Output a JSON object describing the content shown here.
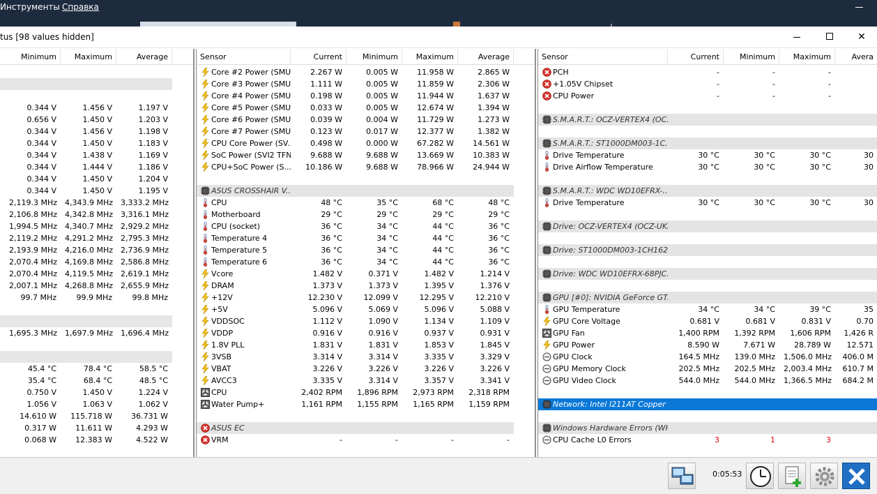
{
  "menu": {
    "tools": "Инструменты",
    "help": "Справка"
  },
  "window": {
    "title": "tus [98 values hidden]"
  },
  "panel1": {
    "headers": [
      "Minimum",
      "Maximum",
      "Average"
    ],
    "rows": [
      {
        "kind": "blank"
      },
      {
        "kind": "sec"
      },
      {
        "kind": "blank"
      },
      {
        "kind": "data",
        "v": [
          "0.344 V",
          "1.456 V",
          "1.197 V"
        ]
      },
      {
        "kind": "data",
        "v": [
          "0.656 V",
          "1.450 V",
          "1.203 V"
        ]
      },
      {
        "kind": "data",
        "v": [
          "0.344 V",
          "1.456 V",
          "1.198 V"
        ]
      },
      {
        "kind": "data",
        "v": [
          "0.344 V",
          "1.450 V",
          "1.183 V"
        ]
      },
      {
        "kind": "data",
        "v": [
          "0.344 V",
          "1.438 V",
          "1.169 V"
        ]
      },
      {
        "kind": "data",
        "v": [
          "0.344 V",
          "1.444 V",
          "1.186 V"
        ]
      },
      {
        "kind": "data",
        "v": [
          "0.344 V",
          "1.450 V",
          "1.204 V"
        ]
      },
      {
        "kind": "data",
        "v": [
          "0.344 V",
          "1.450 V",
          "1.195 V"
        ]
      },
      {
        "kind": "data",
        "v": [
          "2,119.3 MHz",
          "4,343.9 MHz",
          "3,333.2 MHz"
        ]
      },
      {
        "kind": "data",
        "v": [
          "2,106.8 MHz",
          "4,342.8 MHz",
          "3,316.1 MHz"
        ]
      },
      {
        "kind": "data",
        "v": [
          "1,994.5 MHz",
          "4,340.7 MHz",
          "2,929.2 MHz"
        ]
      },
      {
        "kind": "data",
        "v": [
          "2,119.2 MHz",
          "4,291.2 MHz",
          "2,795.3 MHz"
        ]
      },
      {
        "kind": "data",
        "v": [
          "2,193.9 MHz",
          "4,216.0 MHz",
          "2,736.9 MHz"
        ]
      },
      {
        "kind": "data",
        "v": [
          "2,070.4 MHz",
          "4,169.8 MHz",
          "2,586.8 MHz"
        ]
      },
      {
        "kind": "data",
        "v": [
          "2,070.4 MHz",
          "4,119.5 MHz",
          "2,619.1 MHz"
        ]
      },
      {
        "kind": "data",
        "v": [
          "2,007.1 MHz",
          "4,268.8 MHz",
          "2,655.9 MHz"
        ]
      },
      {
        "kind": "data",
        "v": [
          "99.7 MHz",
          "99.9 MHz",
          "99.8 MHz"
        ]
      },
      {
        "kind": "blank"
      },
      {
        "kind": "sec"
      },
      {
        "kind": "data",
        "v": [
          "1,695.3 MHz",
          "1,697.9 MHz",
          "1,696.4 MHz"
        ]
      },
      {
        "kind": "blank"
      },
      {
        "kind": "sec"
      },
      {
        "kind": "data",
        "v": [
          "45.4 °C",
          "78.4 °C",
          "58.5 °C"
        ]
      },
      {
        "kind": "data",
        "v": [
          "35.4 °C",
          "68.4 °C",
          "48.5 °C"
        ]
      },
      {
        "kind": "data",
        "v": [
          "0.750 V",
          "1.450 V",
          "1.224 V"
        ]
      },
      {
        "kind": "data",
        "v": [
          "1.056 V",
          "1.063 V",
          "1.062 V"
        ]
      },
      {
        "kind": "data",
        "v": [
          "14.610 W",
          "115.718 W",
          "36.731 W"
        ]
      },
      {
        "kind": "data",
        "v": [
          "0.317 W",
          "11.611 W",
          "4.293 W"
        ]
      },
      {
        "kind": "data",
        "v": [
          "0.068 W",
          "12.383 W",
          "4.522 W"
        ]
      }
    ]
  },
  "panel2": {
    "headers": [
      "Sensor",
      "Current",
      "Minimum",
      "Maximum",
      "Average"
    ],
    "rows": [
      {
        "kind": "data",
        "icon": "bolt",
        "name": "Core #2 Power (SMU)",
        "v": [
          "2.267 W",
          "0.005 W",
          "11.958 W",
          "2.865 W"
        ]
      },
      {
        "kind": "data",
        "icon": "bolt",
        "name": "Core #3 Power (SMU)",
        "v": [
          "1.111 W",
          "0.005 W",
          "11.859 W",
          "2.306 W"
        ]
      },
      {
        "kind": "data",
        "icon": "bolt",
        "name": "Core #4 Power (SMU)",
        "v": [
          "0.198 W",
          "0.005 W",
          "11.944 W",
          "1.637 W"
        ]
      },
      {
        "kind": "data",
        "icon": "bolt",
        "name": "Core #5 Power (SMU)",
        "v": [
          "0.033 W",
          "0.005 W",
          "12.674 W",
          "1.394 W"
        ]
      },
      {
        "kind": "data",
        "icon": "bolt",
        "name": "Core #6 Power (SMU)",
        "v": [
          "0.039 W",
          "0.004 W",
          "11.729 W",
          "1.273 W"
        ]
      },
      {
        "kind": "data",
        "icon": "bolt",
        "name": "Core #7 Power (SMU)",
        "v": [
          "0.123 W",
          "0.017 W",
          "12.377 W",
          "1.382 W"
        ]
      },
      {
        "kind": "data",
        "icon": "bolt",
        "name": "CPU Core Power (SV...",
        "v": [
          "0.498 W",
          "0.000 W",
          "67.282 W",
          "14.561 W"
        ]
      },
      {
        "kind": "data",
        "icon": "bolt",
        "name": "SoC Power (SVI2 TFN)",
        "v": [
          "9.688 W",
          "9.688 W",
          "13.669 W",
          "10.383 W"
        ]
      },
      {
        "kind": "data",
        "icon": "bolt",
        "name": "CPU+SoC Power (S...",
        "v": [
          "10.186 W",
          "9.688 W",
          "78.966 W",
          "24.944 W"
        ]
      },
      {
        "kind": "blank"
      },
      {
        "kind": "sec",
        "icon": "chip",
        "name": "ASUS CROSSHAIR V..."
      },
      {
        "kind": "data",
        "icon": "temp",
        "name": "CPU",
        "v": [
          "48 °C",
          "35 °C",
          "68 °C",
          "48 °C"
        ]
      },
      {
        "kind": "data",
        "icon": "temp",
        "name": "Motherboard",
        "v": [
          "29 °C",
          "29 °C",
          "29 °C",
          "29 °C"
        ]
      },
      {
        "kind": "data",
        "icon": "temp",
        "name": "CPU (socket)",
        "v": [
          "36 °C",
          "34 °C",
          "44 °C",
          "36 °C"
        ]
      },
      {
        "kind": "data",
        "icon": "temp",
        "name": "Temperature 4",
        "v": [
          "36 °C",
          "34 °C",
          "44 °C",
          "36 °C"
        ]
      },
      {
        "kind": "data",
        "icon": "temp",
        "name": "Temperature 5",
        "v": [
          "36 °C",
          "34 °C",
          "44 °C",
          "36 °C"
        ]
      },
      {
        "kind": "data",
        "icon": "temp",
        "name": "Temperature 6",
        "v": [
          "36 °C",
          "34 °C",
          "44 °C",
          "36 °C"
        ]
      },
      {
        "kind": "data",
        "icon": "bolt",
        "name": "Vcore",
        "v": [
          "1.482 V",
          "0.371 V",
          "1.482 V",
          "1.214 V"
        ]
      },
      {
        "kind": "data",
        "icon": "bolt",
        "name": "DRAM",
        "v": [
          "1.373 V",
          "1.373 V",
          "1.395 V",
          "1.376 V"
        ]
      },
      {
        "kind": "data",
        "icon": "bolt",
        "name": "+12V",
        "v": [
          "12.230 V",
          "12.099 V",
          "12.295 V",
          "12.210 V"
        ]
      },
      {
        "kind": "data",
        "icon": "bolt",
        "name": "+5V",
        "v": [
          "5.096 V",
          "5.069 V",
          "5.096 V",
          "5.088 V"
        ]
      },
      {
        "kind": "data",
        "icon": "bolt",
        "name": "VDDSOC",
        "v": [
          "1.112 V",
          "1.090 V",
          "1.134 V",
          "1.109 V"
        ]
      },
      {
        "kind": "data",
        "icon": "bolt",
        "name": "VDDP",
        "v": [
          "0.916 V",
          "0.916 V",
          "0.937 V",
          "0.931 V"
        ]
      },
      {
        "kind": "data",
        "icon": "bolt",
        "name": "1.8V PLL",
        "v": [
          "1.831 V",
          "1.831 V",
          "1.853 V",
          "1.845 V"
        ]
      },
      {
        "kind": "data",
        "icon": "bolt",
        "name": "3VSB",
        "v": [
          "3.314 V",
          "3.314 V",
          "3.335 V",
          "3.329 V"
        ]
      },
      {
        "kind": "data",
        "icon": "bolt",
        "name": "VBAT",
        "v": [
          "3.226 V",
          "3.226 V",
          "3.226 V",
          "3.226 V"
        ]
      },
      {
        "kind": "data",
        "icon": "bolt",
        "name": "AVCC3",
        "v": [
          "3.335 V",
          "3.314 V",
          "3.357 V",
          "3.341 V"
        ]
      },
      {
        "kind": "data",
        "icon": "fan",
        "name": "CPU",
        "v": [
          "2,402 RPM",
          "1,896 RPM",
          "2,973 RPM",
          "2,318 RPM"
        ]
      },
      {
        "kind": "data",
        "icon": "fan",
        "name": "Water Pump+",
        "v": [
          "1,161 RPM",
          "1,155 RPM",
          "1,165 RPM",
          "1,159 RPM"
        ]
      },
      {
        "kind": "blank"
      },
      {
        "kind": "sec",
        "icon": "error",
        "name": "ASUS EC",
        "gray": true
      },
      {
        "kind": "data",
        "icon": "error",
        "name": "VRM",
        "v": [
          "-",
          "-",
          "-",
          "-"
        ]
      }
    ]
  },
  "panel3": {
    "headers": [
      "Sensor",
      "Current",
      "Minimum",
      "Maximum",
      "Avera"
    ],
    "rows": [
      {
        "kind": "data",
        "icon": "error",
        "name": "PCH",
        "v": [
          "-",
          "-",
          "-",
          ""
        ]
      },
      {
        "kind": "data",
        "icon": "error",
        "name": "+1.05V Chipset",
        "v": [
          "-",
          "-",
          "-",
          ""
        ]
      },
      {
        "kind": "data",
        "icon": "error",
        "name": "CPU Power",
        "v": [
          "-",
          "-",
          "-",
          ""
        ]
      },
      {
        "kind": "blank"
      },
      {
        "kind": "sec",
        "icon": "chip",
        "name": "S.M.A.R.T.: OCZ-VERTEX4 (OC..."
      },
      {
        "kind": "blank"
      },
      {
        "kind": "sec",
        "icon": "chip",
        "name": "S.M.A.R.T.: ST1000DM003-1C..."
      },
      {
        "kind": "data",
        "icon": "temp",
        "name": "Drive Temperature",
        "v": [
          "30 °C",
          "30 °C",
          "30 °C",
          "30"
        ]
      },
      {
        "kind": "data",
        "icon": "temp",
        "name": "Drive Airflow Temperature",
        "v": [
          "30 °C",
          "30 °C",
          "30 °C",
          "30"
        ]
      },
      {
        "kind": "blank"
      },
      {
        "kind": "sec",
        "icon": "chip",
        "name": "S.M.A.R.T.: WDC WD10EFRX-..."
      },
      {
        "kind": "data",
        "icon": "temp",
        "name": "Drive Temperature",
        "v": [
          "30 °C",
          "30 °C",
          "30 °C",
          "30"
        ]
      },
      {
        "kind": "blank"
      },
      {
        "kind": "sec",
        "icon": "chip",
        "name": "Drive: OCZ-VERTEX4 (OCZ-UKF..."
      },
      {
        "kind": "blank"
      },
      {
        "kind": "sec",
        "icon": "chip",
        "name": "Drive: ST1000DM003-1CH162 (..."
      },
      {
        "kind": "blank"
      },
      {
        "kind": "sec",
        "icon": "chip",
        "name": "Drive: WDC WD10EFRX-68PJC..."
      },
      {
        "kind": "blank"
      },
      {
        "kind": "sec",
        "icon": "chip",
        "name": "GPU [#0]: NVIDIA GeForce GT..."
      },
      {
        "kind": "data",
        "icon": "temp",
        "name": "GPU Temperature",
        "v": [
          "34 °C",
          "34 °C",
          "39 °C",
          "35"
        ]
      },
      {
        "kind": "data",
        "icon": "bolt",
        "name": "GPU Core Voltage",
        "v": [
          "0.681 V",
          "0.681 V",
          "0.831 V",
          "0.70"
        ]
      },
      {
        "kind": "data",
        "icon": "fan",
        "name": "GPU Fan",
        "v": [
          "1,400 RPM",
          "1,392 RPM",
          "1,606 RPM",
          "1,426 R"
        ]
      },
      {
        "kind": "data",
        "icon": "bolt",
        "name": "GPU Power",
        "v": [
          "8.590 W",
          "7.671 W",
          "28.789 W",
          "12.571"
        ]
      },
      {
        "kind": "data",
        "icon": "clock",
        "name": "GPU Clock",
        "v": [
          "164.5 MHz",
          "139.0 MHz",
          "1,506.0 MHz",
          "406.0 M"
        ]
      },
      {
        "kind": "data",
        "icon": "clock",
        "name": "GPU Memory Clock",
        "v": [
          "202.5 MHz",
          "202.5 MHz",
          "2,003.4 MHz",
          "610.7 M"
        ]
      },
      {
        "kind": "data",
        "icon": "clock",
        "name": "GPU Video Clock",
        "v": [
          "544.0 MHz",
          "544.0 MHz",
          "1,366.5 MHz",
          "684.2 M"
        ]
      },
      {
        "kind": "blank"
      },
      {
        "kind": "sel",
        "icon": "chip",
        "name": "Network: Intel I211AT Copper ..."
      },
      {
        "kind": "blank"
      },
      {
        "kind": "sec",
        "icon": "chip",
        "name": "Windows Hardware Errors (WH..."
      },
      {
        "kind": "data",
        "icon": "clock",
        "name": "CPU Cache L0 Errors",
        "v": [
          "3",
          "1",
          "3",
          ""
        ],
        "red": true
      }
    ]
  },
  "statusbar": {
    "elapsed": "0:05:53"
  }
}
